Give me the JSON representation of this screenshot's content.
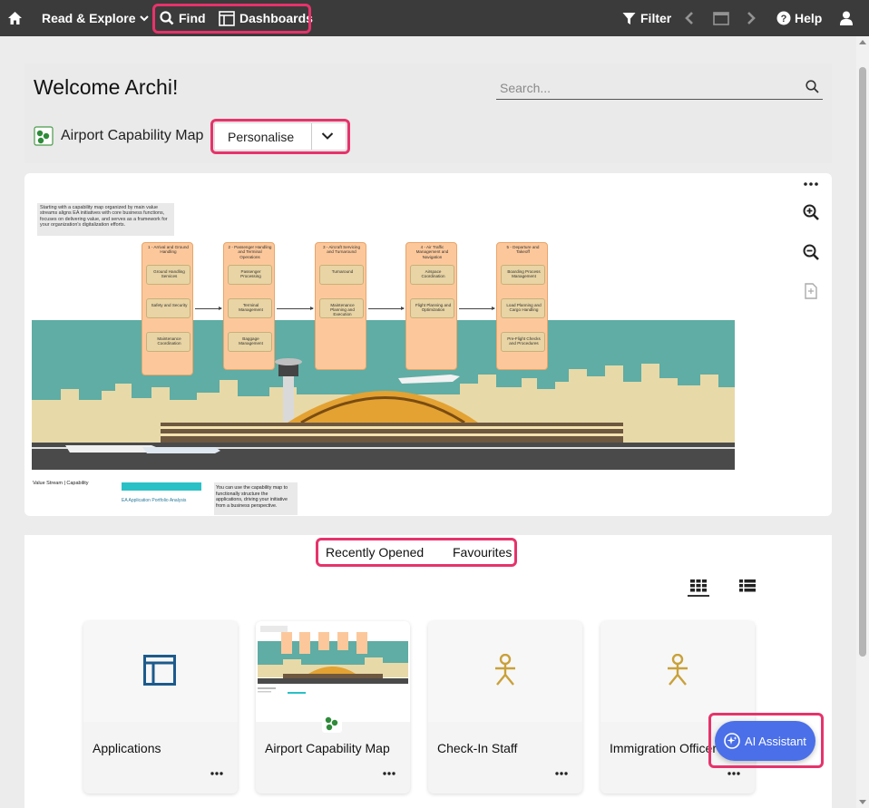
{
  "topbar": {
    "home_icon": "home-icon",
    "read_explore_label": "Read & Explore",
    "find_label": "Find",
    "dashboards_label": "Dashboards",
    "filter_label": "Filter",
    "help_label": "Help",
    "user_icon": "user-icon"
  },
  "welcome": {
    "title": "Welcome Archi!",
    "search_placeholder": "Search..."
  },
  "capability_map": {
    "title": "Airport Capability Map",
    "personalise_label": "Personalise"
  },
  "map_preview": {
    "intro_text": "Starting with a capability map organized by main value streams aligns EA initiatives with core business functions, focuses on delivering value, and serves as a framework for your organization's digitalization efforts.",
    "value_streams": [
      {
        "title": "1 - Arrival and Ground Handling",
        "capabilities": [
          "Ground Handling Services",
          "Safety and Security",
          "Maintenance Coordination"
        ]
      },
      {
        "title": "2 - Passenger Handling and Terminal Operations",
        "capabilities": [
          "Passenger Processing",
          "Terminal Management",
          "Baggage Management"
        ]
      },
      {
        "title": "3 - Aircraft Servicing and Turnaround",
        "capabilities": [
          "Turnaround",
          "Maintenance Planning and Execution"
        ]
      },
      {
        "title": "4 - Air Traffic Management and Navigation",
        "capabilities": [
          "Airspace Coordination",
          "Flight Planning and Optimization"
        ]
      },
      {
        "title": "5 - Departure and Takeoff",
        "capabilities": [
          "Boarding Process Management",
          "Load Planning and Cargo Handling",
          "Pre-Flight Checks and Procedures"
        ]
      }
    ],
    "legend_text": "Value Stream | Capability",
    "legend_link": "EA Application Portfolio Analysis",
    "outro_text": "You can use the capability map to functionally structure the applications, driving your initiative from a business perspective."
  },
  "recent": {
    "tab_recent": "Recently Opened",
    "tab_favourites": "Favourites",
    "tiles": [
      {
        "name": "Applications",
        "icon": "view-layout-icon"
      },
      {
        "name": "Airport Capability Map",
        "icon": "capability-map-icon"
      },
      {
        "name": "Check-In Staff",
        "icon": "actor-icon"
      },
      {
        "name": "Immigration Officer",
        "icon": "actor-icon"
      }
    ]
  },
  "ai_assistant": {
    "label": "AI Assistant"
  },
  "colors": {
    "topbar": "#3b3b3b",
    "highlight": "#e6336b",
    "accent_blue": "#4a6fe8",
    "capability_box": "#fcc89b",
    "sky": "#5fada4",
    "icon_blue": "#1d5a8c",
    "actor_gold": "#c9a13a"
  }
}
